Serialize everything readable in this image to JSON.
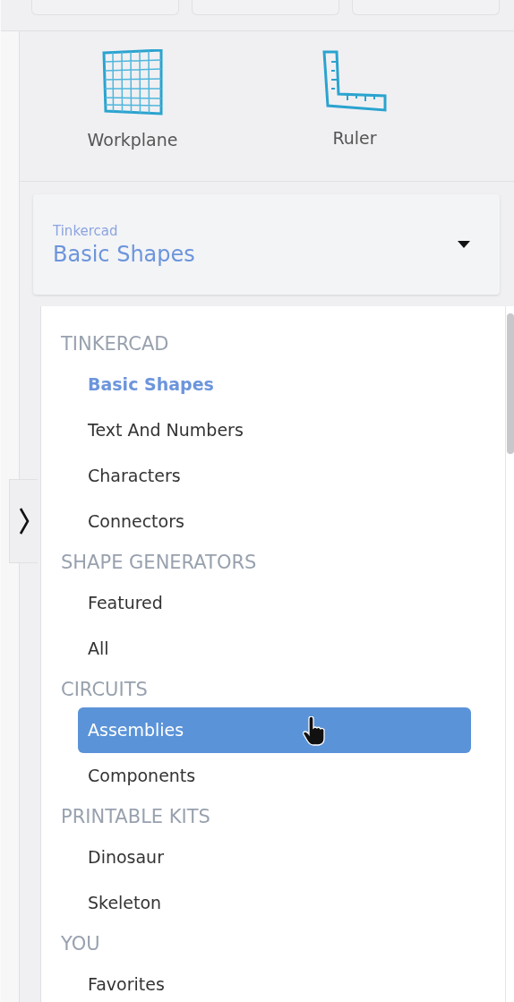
{
  "tools": [
    {
      "kind": "workplane",
      "label": "Workplane"
    },
    {
      "kind": "ruler",
      "label": "Ruler"
    }
  ],
  "library_select": {
    "label": "Tinkercad",
    "value": "Basic Shapes"
  },
  "library": [
    {
      "heading": "TINKERCAD",
      "items": [
        {
          "label": "Basic Shapes",
          "current": true,
          "selected": false
        },
        {
          "label": "Text And Numbers",
          "current": false,
          "selected": false
        },
        {
          "label": "Characters",
          "current": false,
          "selected": false
        },
        {
          "label": "Connectors",
          "current": false,
          "selected": false
        }
      ]
    },
    {
      "heading": "SHAPE GENERATORS",
      "items": [
        {
          "label": "Featured",
          "current": false,
          "selected": false
        },
        {
          "label": "All",
          "current": false,
          "selected": false
        }
      ]
    },
    {
      "heading": "CIRCUITS",
      "items": [
        {
          "label": "Assemblies",
          "current": false,
          "selected": true
        },
        {
          "label": "Components",
          "current": false,
          "selected": false
        }
      ]
    },
    {
      "heading": "PRINTABLE KITS",
      "items": [
        {
          "label": "Dinosaur",
          "current": false,
          "selected": false
        },
        {
          "label": "Skeleton",
          "current": false,
          "selected": false
        }
      ]
    },
    {
      "heading": "YOU",
      "items": [
        {
          "label": "Favorites",
          "current": false,
          "selected": false
        }
      ]
    }
  ]
}
